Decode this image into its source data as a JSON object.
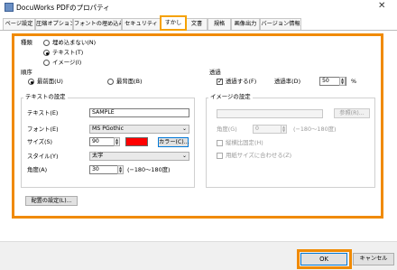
{
  "window": {
    "title": "DocuWorks PDFのプロパティ",
    "close_glyph": "✕"
  },
  "tabs": [
    {
      "label": "ページ設定"
    },
    {
      "label": "圧縮オプション"
    },
    {
      "label": "フォントの埋め込み"
    },
    {
      "label": "セキュリティ"
    },
    {
      "label": "すかし"
    },
    {
      "label": "文書"
    },
    {
      "label": "規格"
    },
    {
      "label": "画像出力"
    },
    {
      "label": "バージョン情報"
    }
  ],
  "type": {
    "label": "種類",
    "options": [
      {
        "label": "埋め込まない(N)",
        "selected": false
      },
      {
        "label": "テキスト(T)",
        "selected": true
      },
      {
        "label": "イメージ(I)",
        "selected": false
      }
    ]
  },
  "order": {
    "label": "順序",
    "options": [
      {
        "label": "最前面(U)",
        "selected": true
      },
      {
        "label": "最背面(B)",
        "selected": false
      }
    ]
  },
  "transparency": {
    "label": "透過",
    "checkbox_label": "透過する(F)",
    "checked": true,
    "rate_label": "透過率(D)",
    "rate_value": "50",
    "unit": "%"
  },
  "text_settings": {
    "group_label": "テキストの設定",
    "text_label": "テキスト(E)",
    "text_value": "SAMPLE",
    "font_label": "フォント(E)",
    "font_value": "MS PGothic",
    "size_label": "サイズ(S)",
    "size_value": "90",
    "color_value": "#ff0000",
    "color_button": "カラー(C)...",
    "style_label": "スタイル(Y)",
    "style_value": "太字",
    "angle_label": "角度(A)",
    "angle_value": "30",
    "angle_range": "(−180〜180度)"
  },
  "image_settings": {
    "group_label": "イメージの設定",
    "browse_button": "参照(R)...",
    "angle_label": "角度(G)",
    "angle_value": "0",
    "angle_range": "(−180〜180度)",
    "keep_ratio_label": "縦横比固定(H)",
    "fit_paper_label": "用紙サイズに合わせる(Z)"
  },
  "placement_button": "配置の設定(L)...",
  "ok_button": "OK",
  "cancel_button": "キャンセル",
  "colors": {
    "highlight": "#f08a00",
    "swatch": "#ff0000"
  }
}
